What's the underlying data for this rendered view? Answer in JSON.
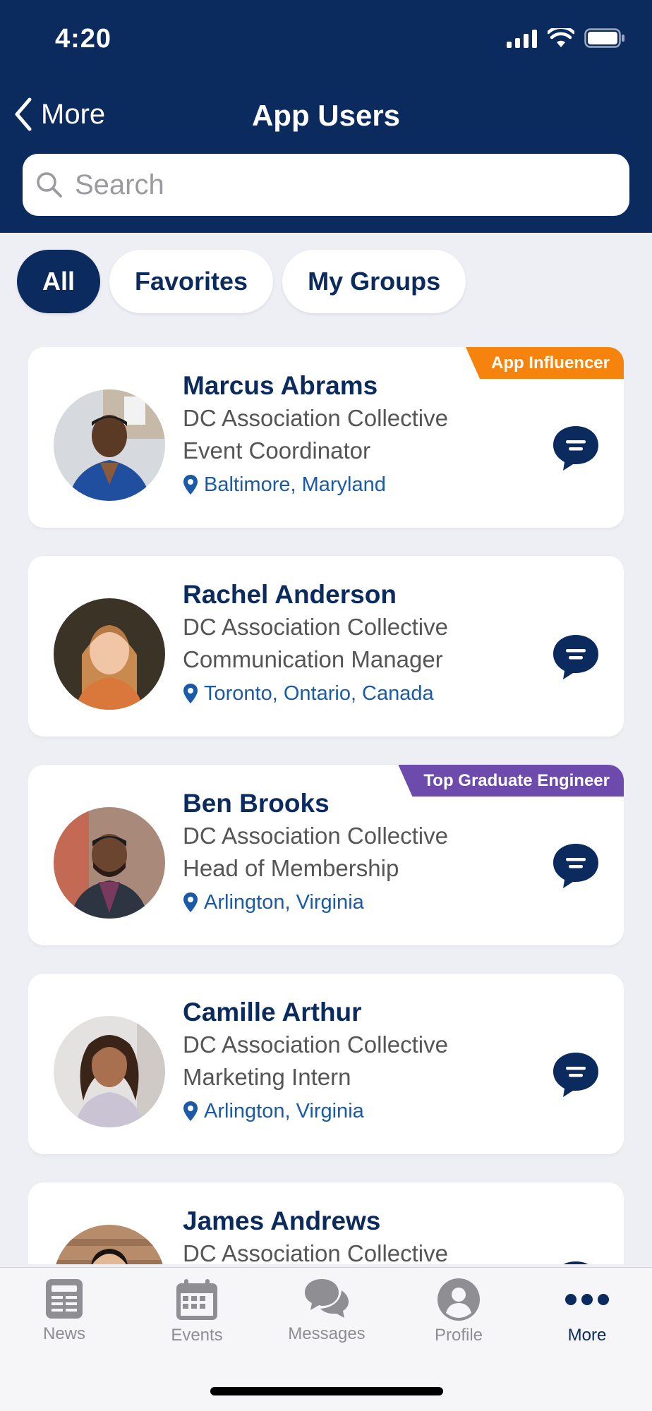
{
  "status_bar": {
    "time": "4:20"
  },
  "header": {
    "back_label": "More",
    "title": "App Users"
  },
  "search": {
    "placeholder": "Search"
  },
  "filters": [
    {
      "label": "All",
      "active": true
    },
    {
      "label": "Favorites",
      "active": false
    },
    {
      "label": "My Groups",
      "active": false
    }
  ],
  "users": [
    {
      "name": "Marcus Abrams",
      "organization": "DC Association Collective",
      "role": "Event Coordinator",
      "location": "Baltimore, Maryland",
      "badge": "App Influencer",
      "badge_color": "#f7830f"
    },
    {
      "name": "Rachel Anderson",
      "organization": "DC Association Collective",
      "role": "Communication Manager",
      "location": "Toronto, Ontario, Canada",
      "badge": "",
      "badge_color": ""
    },
    {
      "name": "Ben Brooks",
      "organization": "DC Association Collective",
      "role": "Head of Membership",
      "location": "Arlington, Virginia",
      "badge": "Top Graduate Engineer",
      "badge_color": "#6c4bad"
    },
    {
      "name": "Camille Arthur",
      "organization": "DC Association Collective",
      "role": "Marketing Intern",
      "location": "Arlington, Virginia",
      "badge": "",
      "badge_color": ""
    },
    {
      "name": "James Andrews",
      "organization": "DC Association Collective",
      "role": "",
      "location": "",
      "badge": "",
      "badge_color": ""
    }
  ],
  "tabs": [
    {
      "label": "News",
      "icon": "newspaper-icon"
    },
    {
      "label": "Events",
      "icon": "calendar-icon"
    },
    {
      "label": "Messages",
      "icon": "chat-bubbles-icon"
    },
    {
      "label": "Profile",
      "icon": "person-icon"
    },
    {
      "label": "More",
      "icon": "more-dots-icon",
      "active": true
    }
  ],
  "colors": {
    "brand": "#0b2a5e",
    "link": "#1a5aa6",
    "badge_orange": "#f7830f",
    "badge_purple": "#6c4bad"
  }
}
